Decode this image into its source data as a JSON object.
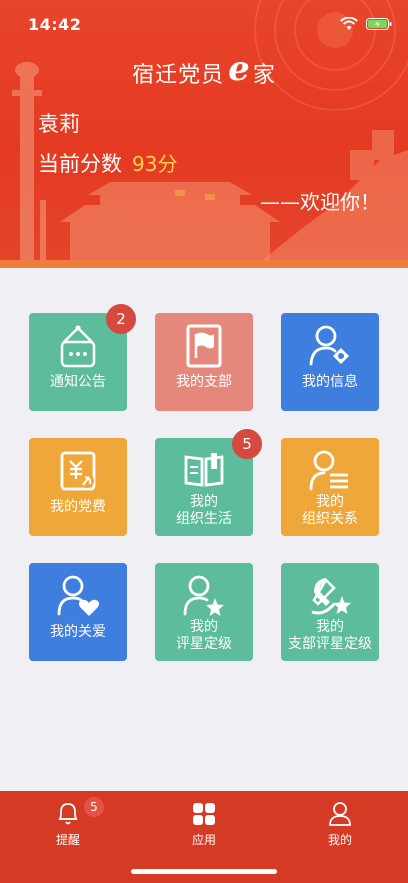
{
  "status_bar": {
    "time": "14:42"
  },
  "header": {
    "title_prefix": "宿迁党员",
    "title_e": "e",
    "title_suffix": "家",
    "user_name": "袁莉",
    "score_label": "当前分数",
    "score_value": "93分",
    "welcome": "——欢迎你！"
  },
  "tiles": [
    {
      "label": "通知公告",
      "color": "#5cbc9b",
      "icon": "notice-board-icon",
      "badge": "2"
    },
    {
      "label": "我的支部",
      "color": "#e5877a",
      "icon": "flag-book-icon"
    },
    {
      "label": "我的信息",
      "color": "#3d7ede",
      "icon": "person-info-icon"
    },
    {
      "label_line1": "我的党费",
      "color": "#f0a739",
      "icon": "party-fee-icon"
    },
    {
      "label_line1": "我的",
      "label_line2": "组织生活",
      "color": "#5cbc9b",
      "icon": "open-book-icon",
      "badge": "5"
    },
    {
      "label_line1": "我的",
      "label_line2": "组织关系",
      "color": "#f0a739",
      "icon": "person-list-icon"
    },
    {
      "label": "我的关爱",
      "color": "#3d7ede",
      "icon": "person-heart-icon"
    },
    {
      "label_line1": "我的",
      "label_line2": "评星定级",
      "color": "#5cbc9b",
      "icon": "person-star-icon"
    },
    {
      "label_line1": "我的",
      "label_line2": "支部评星定级",
      "color": "#5cbc9b",
      "icon": "party-star-icon"
    }
  ],
  "tabbar": {
    "items": [
      {
        "label": "提醒",
        "icon": "bell-icon",
        "badge": "5"
      },
      {
        "label": "应用",
        "icon": "apps-grid-icon"
      },
      {
        "label": "我的",
        "icon": "person-icon"
      }
    ],
    "background": "#d53a24"
  }
}
